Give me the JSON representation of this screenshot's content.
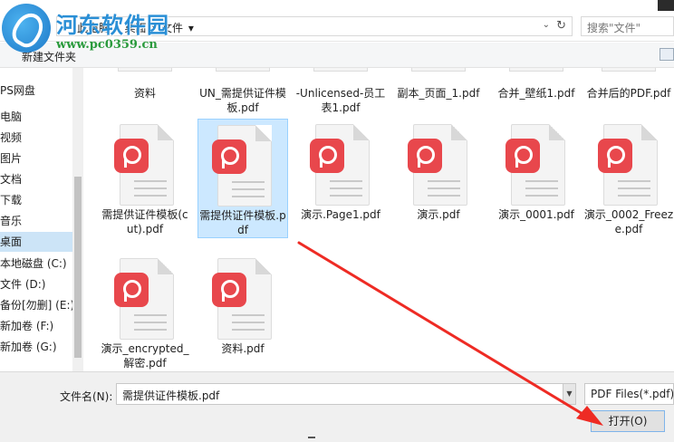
{
  "watermark": {
    "title": "河东软件园",
    "url": "www.pc0359.cn"
  },
  "address": {
    "crumbs": [
      "此电脑",
      "桌面",
      "文件"
    ],
    "separator": "›",
    "search_placeholder": "搜索\"文件\""
  },
  "toolbar": {
    "new_folder": "新建文件夹"
  },
  "sidebar": {
    "items": [
      {
        "label": "PS网盘"
      },
      {
        "label": "电脑"
      },
      {
        "label": "视频"
      },
      {
        "label": "图片"
      },
      {
        "label": "文档"
      },
      {
        "label": "下载"
      },
      {
        "label": "音乐"
      },
      {
        "label": "桌面",
        "selected": true
      },
      {
        "label": "本地磁盘 (C:)"
      },
      {
        "label": "文件 (D:)"
      },
      {
        "label": "备份[勿删] (E:)"
      },
      {
        "label": "新加卷 (F:)"
      },
      {
        "label": "新加卷 (G:)"
      }
    ]
  },
  "files": {
    "top_row": [
      {
        "name": "资料"
      },
      {
        "name": "UN_需提供证件模板.pdf"
      },
      {
        "name": "-Unlicensed-员工表1.pdf"
      },
      {
        "name": "副本_页面_1.pdf"
      },
      {
        "name": "合并_壁纸1.pdf"
      },
      {
        "name": "合并后的PDF.pdf"
      }
    ],
    "row2": [
      {
        "name": "需提供证件模板(cut).pdf"
      },
      {
        "name": "需提供证件模板.pdf",
        "selected": true
      },
      {
        "name": "演示.Page1.pdf"
      },
      {
        "name": "演示.pdf"
      },
      {
        "name": "演示_0001.pdf"
      },
      {
        "name": "演示_0002_Freeze.pdf"
      }
    ],
    "row3": [
      {
        "name": "演示_encrypted_解密.pdf"
      },
      {
        "name": "资料.pdf"
      }
    ]
  },
  "footer": {
    "filename_label": "文件名(N):",
    "filename_value": "需提供证件模板.pdf",
    "filetype": "PDF Files(*.pdf)",
    "open_button": "打开(O)"
  },
  "colors": {
    "pdf_badge": "#e8474c",
    "selection": "#cce8ff",
    "arrow": "#ee2b24",
    "watermark_title": "#2a8fd6",
    "watermark_url": "#2a9a3c"
  }
}
